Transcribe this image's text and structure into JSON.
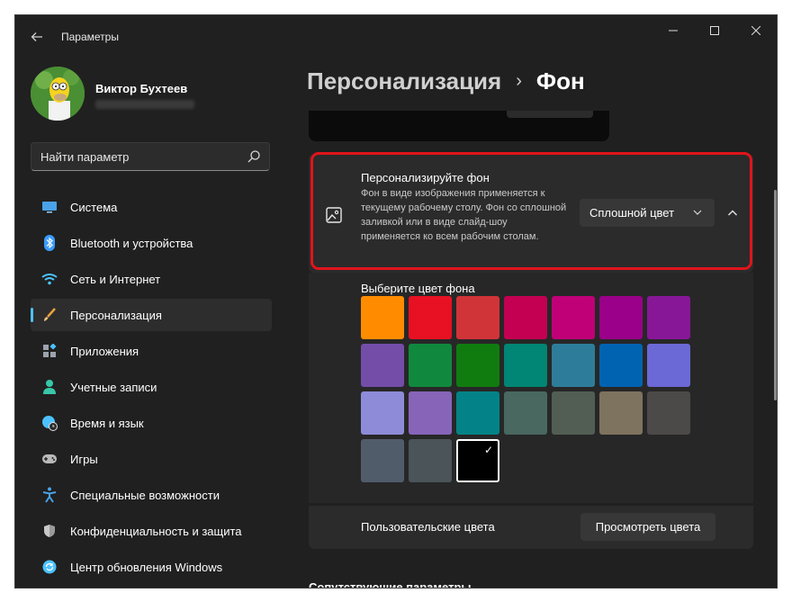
{
  "window": {
    "app_title": "Параметры",
    "back_icon": "arrow-left-icon",
    "controls": {
      "minimize": "—",
      "maximize": "☐",
      "close": "✕"
    }
  },
  "profile": {
    "name": "Виктор Бухтеев"
  },
  "search": {
    "placeholder": "Найти параметр"
  },
  "nav": {
    "items": [
      {
        "label": "Система",
        "icon": "display-icon",
        "color": "#4aa3e8"
      },
      {
        "label": "Bluetooth и устройства",
        "icon": "bluetooth-icon",
        "color": "#3b9cff"
      },
      {
        "label": "Сеть и Интернет",
        "icon": "wifi-icon",
        "color": "#4cc2ff"
      },
      {
        "label": "Персонализация",
        "icon": "brush-icon",
        "color": "#e8a33b",
        "active": true
      },
      {
        "label": "Приложения",
        "icon": "apps-icon",
        "color": "#9da3ad"
      },
      {
        "label": "Учетные записи",
        "icon": "person-icon",
        "color": "#38c7a8"
      },
      {
        "label": "Время и язык",
        "icon": "globe-clock-icon",
        "color": "#4cc2ff"
      },
      {
        "label": "Игры",
        "icon": "gamepad-icon",
        "color": "#b9b9b9"
      },
      {
        "label": "Специальные возможности",
        "icon": "accessibility-icon",
        "color": "#4aa3e8"
      },
      {
        "label": "Конфиденциальность и защита",
        "icon": "shield-icon",
        "color": "#9a9a9a"
      },
      {
        "label": "Центр обновления Windows",
        "icon": "update-icon",
        "color": "#4cc2ff"
      }
    ]
  },
  "breadcrumb": {
    "parent": "Персонализация",
    "separator": "›",
    "current": "Фон"
  },
  "background_card": {
    "title": "Персонализируйте фон",
    "description": "Фон в виде изображения применяется к текущему рабочему столу. Фон со сплошной заливкой или в виде слайд-шоу применяется ко всем рабочим столам.",
    "dropdown_value": "Сплошной цвет"
  },
  "color_picker": {
    "title": "Выберите цвет фона",
    "selected_color": "#000000",
    "swatches": [
      "#FF8C00",
      "#E81123",
      "#D13438",
      "#C30052",
      "#BF0077",
      "#9A0089",
      "#881798",
      "#744DA9",
      "#10893E",
      "#107C10",
      "#018574",
      "#2D7D9A",
      "#0063B1",
      "#6B69D6",
      "#8E8CD8",
      "#8764B8",
      "#038387",
      "#486860",
      "#525E54",
      "#7E735F",
      "#4C4A48",
      "#515C6B",
      "#4A5459",
      "#000000"
    ]
  },
  "custom_colors": {
    "label": "Пользовательские цвета",
    "button": "Просмотреть цвета"
  },
  "related": {
    "title": "Сопутствующие параметры"
  },
  "theme": {
    "accent": "#4CC2FF",
    "highlight_border": "#E0141B",
    "background": "#202020"
  }
}
